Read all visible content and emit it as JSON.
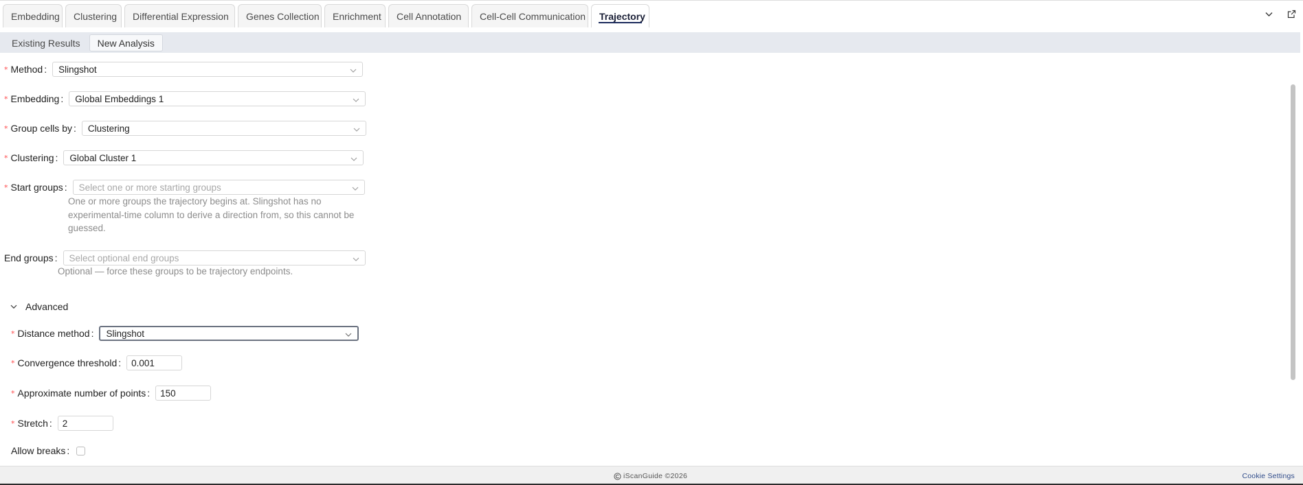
{
  "tabs": [
    {
      "label": "Embedding"
    },
    {
      "label": "Clustering"
    },
    {
      "label": "Differential Expression"
    },
    {
      "label": "Genes Collection"
    },
    {
      "label": "Enrichment"
    },
    {
      "label": "Cell Annotation"
    },
    {
      "label": "Cell-Cell Communication"
    },
    {
      "label": "Trajectory",
      "active": true
    }
  ],
  "subtabs": [
    {
      "label": "Existing Results"
    },
    {
      "label": "New Analysis",
      "active": true
    }
  ],
  "form": {
    "method": {
      "label": "Method",
      "value": "Slingshot"
    },
    "embedding": {
      "label": "Embedding",
      "value": "Global Embeddings 1"
    },
    "group_by": {
      "label": "Group cells by",
      "value": "Clustering"
    },
    "clustering": {
      "label": "Clustering",
      "value": "Global Cluster 1"
    },
    "start_groups": {
      "label": "Start groups",
      "placeholder": "Select one or more starting groups",
      "help_lines": [
        "One or more groups the trajectory begins at. Slingshot has no",
        "experimental-time column to derive a direction from, so this cannot be",
        "guessed."
      ]
    },
    "end_groups": {
      "label": "End groups",
      "placeholder": "Select optional end groups",
      "help": "Optional — force these groups to be trajectory endpoints."
    }
  },
  "advanced": {
    "label": "Advanced",
    "distance_method": {
      "label": "Distance method",
      "value": "Slingshot"
    },
    "convergence": {
      "label": "Convergence threshold",
      "value": "0.001"
    },
    "points": {
      "label": "Approximate number of points",
      "value": "150"
    },
    "stretch": {
      "label": "Stretch",
      "value": "2"
    },
    "allow_breaks": {
      "label": "Allow breaks",
      "checked": false
    }
  },
  "footer": {
    "copyright": "iScanGuide ©2026",
    "cookie": "Cookie Settings"
  },
  "colors": {
    "required": "#ff4d4f",
    "active_tab_underline": "#1a2a5c",
    "link": "#2f4b8a"
  }
}
